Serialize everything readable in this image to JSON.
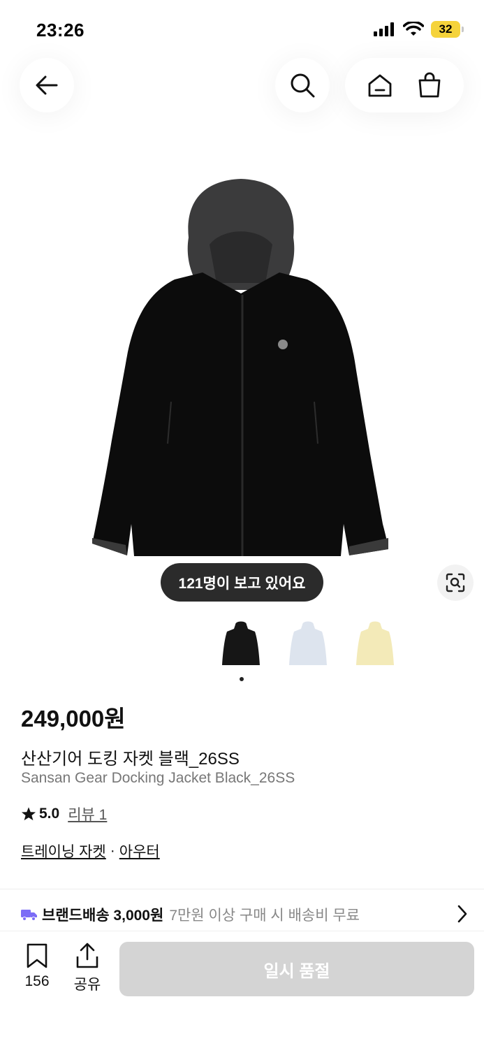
{
  "status_bar": {
    "time": "23:26",
    "battery": "32"
  },
  "header": {
    "back_icon": "arrow-left-icon",
    "search_icon": "search-icon",
    "home_icon": "home-icon",
    "cart_icon": "shopping-bag-icon"
  },
  "hero": {
    "viewing_text": "121명이 보고 있어요",
    "scan_icon": "image-search-icon"
  },
  "thumbnails": [
    {
      "color": "#1a1a1a",
      "label": "black"
    },
    {
      "color": "#dde4ee",
      "label": "light-blue"
    },
    {
      "color": "#f3eab8",
      "label": "cream"
    }
  ],
  "product": {
    "price": "249,000원",
    "name_ko": "산산기어 도킹 자켓 블랙_26SS",
    "name_en": "Sansan Gear Docking Jacket Black_26SS",
    "rating": "5.0",
    "review_label": "리뷰 1",
    "category_1": "트레이닝 자켓",
    "category_sep": "·",
    "category_2": "아우터"
  },
  "shipping": {
    "bold": "브랜드배송 3,000원",
    "note": "7만원 이상 구매 시 배송비 무료",
    "icon_color": "#7b6cf6"
  },
  "bottom_bar": {
    "bookmark_count": "156",
    "share_label": "공유",
    "soldout_label": "일시 품절"
  }
}
